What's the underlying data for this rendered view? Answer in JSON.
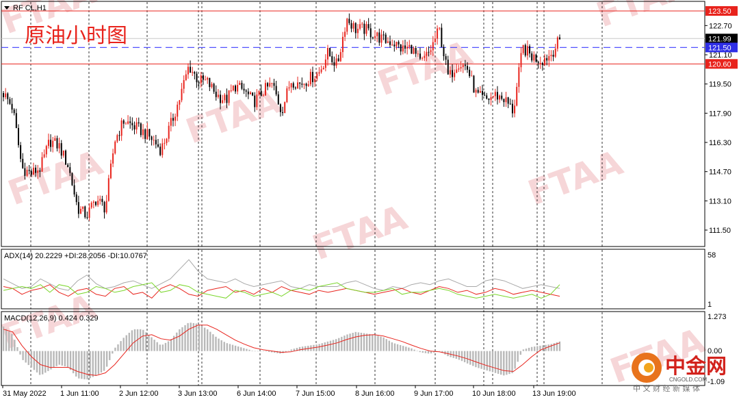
{
  "symbol": "RF CL,H1",
  "title_cn": "原油小时图",
  "watermark": "FTAA",
  "logo": {
    "cn": "中金网",
    "domain": "CNGOLD.COM",
    "tagline": "中 文 财 经 新 媒 体"
  },
  "colors": {
    "bull": "#e8231c",
    "bear": "#000000",
    "hline": "#e8231c",
    "dashed": "#3b3bff",
    "adx_main": "#a8a8a8",
    "plus_di": "#e8231c",
    "minus_di": "#7ad62a",
    "macd_hist": "#b8b8b8",
    "macd_signal": "#e8231c"
  },
  "price_axis": {
    "ticks": [
      "122.70",
      "121.10",
      "119.50",
      "117.90",
      "116.30",
      "114.70",
      "113.10",
      "111.50"
    ],
    "min": 110.9,
    "max": 123.8
  },
  "hlines": [
    {
      "name": "resistance-line",
      "value": 123.5,
      "label": "123.50",
      "style": "solid"
    },
    {
      "name": "current-price",
      "value": 121.99,
      "label": "121.99",
      "style": "label"
    },
    {
      "name": "dashed-level",
      "value": 121.5,
      "label": "121.50",
      "style": "dashed"
    },
    {
      "name": "support-line",
      "value": 120.6,
      "label": "120.60",
      "style": "solid"
    }
  ],
  "time_axis": [
    "31 May 2022",
    "1 Jun 11:00",
    "2 Jun 12:00",
    "3 Jun 13:00",
    "6 Jun 14:00",
    "7 Jun 15:00",
    "8 Jun 16:00",
    "9 Jun 17:00",
    "10 Jun 18:00",
    "13 Jun 19:00"
  ],
  "adx": {
    "label": "ADX(14) 20.2229 +DI:28.2056 -DI:10.0767",
    "max_label": "58",
    "min_label": "1"
  },
  "macd": {
    "label": "MACD(12,26,9) 0.424 0.329",
    "max_label": "1.273",
    "zero_label": "0.00",
    "min_label": "-1.09"
  },
  "chart_data": {
    "type": "candlestick",
    "timeframe": "H1",
    "ylim": [
      110.9,
      123.8
    ],
    "close_path": [
      119.0,
      118.2,
      114.9,
      114.6,
      114.9,
      116.4,
      116.1,
      115.0,
      112.7,
      112.3,
      113.2,
      112.7,
      116.4,
      117.5,
      117.2,
      116.9,
      116.5,
      115.9,
      117.2,
      118.7,
      120.5,
      119.7,
      119.6,
      118.9,
      118.6,
      119.4,
      119.1,
      118.5,
      119.1,
      119.5,
      118.0,
      119.7,
      119.5,
      119.8,
      120.1,
      121.2,
      120.5,
      123.1,
      122.5,
      122.5,
      122.2,
      121.9,
      121.8,
      121.4,
      121.5,
      120.6,
      121.3,
      122.5,
      119.8,
      120.7,
      120.4,
      118.9,
      118.6,
      118.9,
      118.7,
      118.0,
      121.5,
      121.0,
      120.8,
      121.1,
      121.9
    ],
    "adx_series": {
      "adx": [
        30,
        25,
        20,
        22,
        30,
        25,
        20,
        18,
        28,
        34,
        25,
        20,
        22,
        26,
        28,
        24,
        20,
        25,
        30,
        40,
        50,
        38,
        30,
        28,
        26,
        30,
        25,
        22,
        24,
        26,
        28,
        22,
        20,
        24,
        22,
        22,
        22,
        26,
        28,
        24,
        20,
        18,
        22,
        20,
        24,
        26,
        24,
        28,
        30,
        26,
        22,
        22,
        28,
        30,
        28,
        24,
        20,
        22,
        24,
        22,
        20
      ],
      "plus_di": [
        22,
        20,
        14,
        18,
        20,
        24,
        16,
        12,
        18,
        20,
        14,
        12,
        20,
        22,
        14,
        16,
        10,
        20,
        24,
        20,
        14,
        12,
        18,
        20,
        22,
        16,
        18,
        14,
        20,
        16,
        22,
        18,
        16,
        14,
        18,
        16,
        18,
        20,
        18,
        16,
        14,
        16,
        18,
        20,
        16,
        14,
        18,
        22,
        20,
        16,
        18,
        14,
        16,
        20,
        18,
        14,
        16,
        18,
        16,
        14,
        12
      ],
      "minus_di": [
        18,
        20,
        22,
        20,
        24,
        16,
        24,
        22,
        14,
        16,
        22,
        20,
        16,
        18,
        22,
        24,
        26,
        16,
        18,
        24,
        22,
        16,
        14,
        12,
        10,
        18,
        16,
        12,
        14,
        16,
        12,
        18,
        20,
        18,
        22,
        24,
        26,
        20,
        18,
        16,
        16,
        18,
        20,
        14,
        16,
        16,
        18,
        20,
        18,
        14,
        12,
        10,
        12,
        14,
        12,
        10,
        12,
        14,
        10,
        14,
        24
      ]
    },
    "macd_series": {
      "hist": [
        0.9,
        0.6,
        -0.3,
        -0.6,
        -0.9,
        -0.7,
        -0.5,
        -0.6,
        -1.0,
        -1.05,
        -0.9,
        -0.7,
        0.1,
        0.5,
        0.8,
        0.8,
        0.5,
        0.2,
        0.4,
        0.8,
        1.05,
        1.0,
        0.8,
        0.5,
        0.3,
        0.2,
        0.1,
        0.0,
        0.0,
        -0.05,
        -0.1,
        0.05,
        0.15,
        0.2,
        0.25,
        0.35,
        0.45,
        0.6,
        0.7,
        0.65,
        0.6,
        0.5,
        0.3,
        0.2,
        0.1,
        -0.05,
        -0.1,
        0.0,
        -0.2,
        -0.3,
        -0.45,
        -0.6,
        -0.7,
        -0.8,
        -0.9,
        -0.8,
        0.05,
        0.15,
        0.2,
        0.25,
        0.35
      ],
      "signal": [
        0.8,
        0.7,
        0.2,
        -0.2,
        -0.5,
        -0.6,
        -0.6,
        -0.6,
        -0.75,
        -0.85,
        -0.9,
        -0.8,
        -0.5,
        -0.1,
        0.3,
        0.55,
        0.6,
        0.45,
        0.4,
        0.55,
        0.8,
        0.95,
        0.95,
        0.8,
        0.6,
        0.4,
        0.25,
        0.12,
        0.05,
        0.0,
        -0.05,
        -0.03,
        0.05,
        0.1,
        0.15,
        0.22,
        0.3,
        0.42,
        0.52,
        0.58,
        0.6,
        0.55,
        0.45,
        0.35,
        0.22,
        0.1,
        0.0,
        -0.03,
        -0.1,
        -0.18,
        -0.28,
        -0.4,
        -0.52,
        -0.62,
        -0.72,
        -0.75,
        -0.5,
        -0.2,
        0.05,
        0.18,
        0.3
      ]
    }
  }
}
